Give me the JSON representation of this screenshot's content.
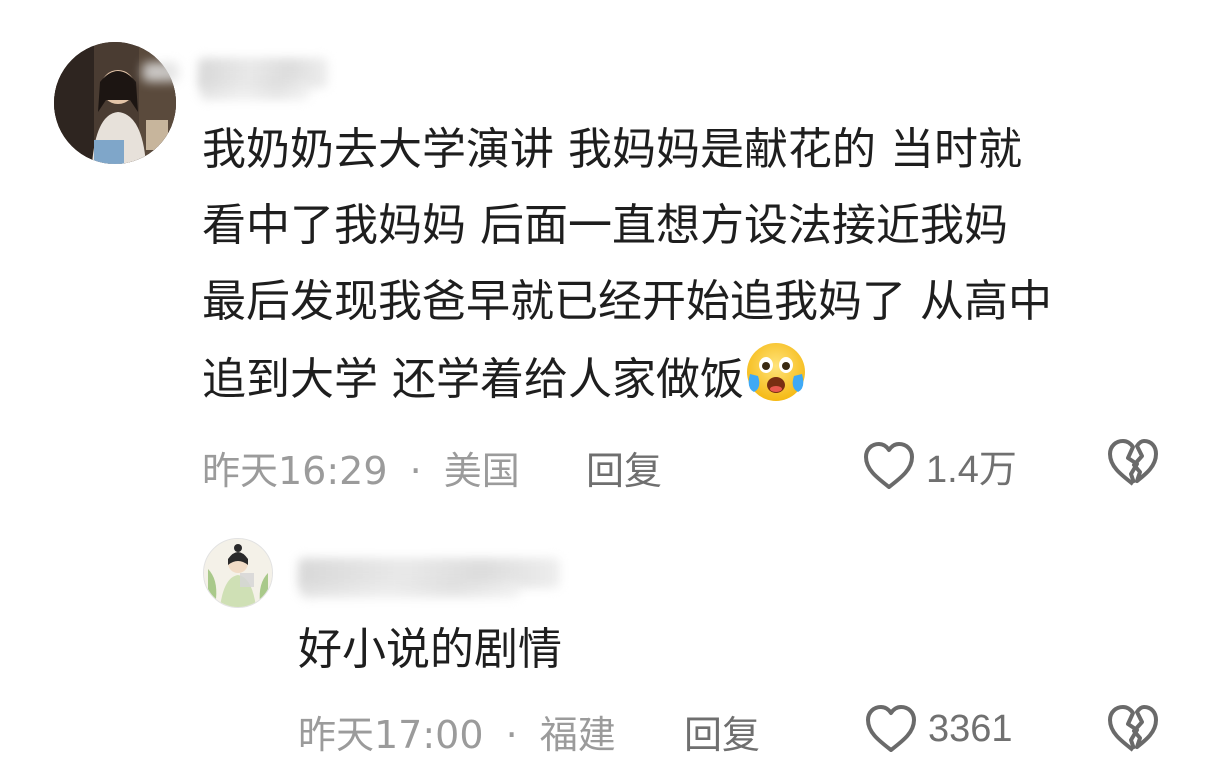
{
  "comments": [
    {
      "lines": [
        "我奶奶去大学演讲 我妈妈是献花的 当时就",
        "看中了我妈妈 后面一直想方设法接近我妈",
        "最后发现我爸早就已经开始追我妈了 从高中",
        "追到大学 还学着给人家做饭"
      ],
      "emoji": "crying-laughing-emoji",
      "time": "昨天16:29",
      "separator": "·",
      "location": "美国",
      "reply_label": "回复",
      "like_count": "1.4万"
    },
    {
      "lines": [
        "好小说的剧情"
      ],
      "time": "昨天17:00",
      "separator": "·",
      "location": "福建",
      "reply_label": "回复",
      "like_count": "3361"
    }
  ],
  "colors": {
    "meta": "#9b9b9b",
    "reply": "#6f6f6f",
    "icon": "#6a6a6a"
  }
}
